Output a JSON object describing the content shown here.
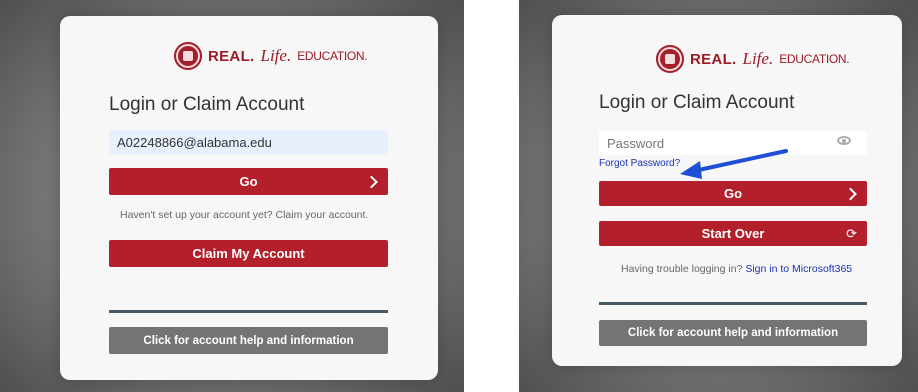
{
  "left": {
    "logo": {
      "seal": "university-seal-icon",
      "real": "REAL.",
      "life": "Life.",
      "edu": "EDUCATION."
    },
    "title": "Login or Claim Account",
    "email_value": "A02248866@alabama.edu",
    "go_label": "Go",
    "claim_note": "Haven't set up your account yet? Claim your account.",
    "claim_button": "Claim My Account",
    "help_button": "Click for account help and information"
  },
  "right": {
    "logo": {
      "seal": "university-seal-icon",
      "real": "REAL.",
      "life": "Life.",
      "edu": "EDUCATION."
    },
    "title": "Login or Claim Account",
    "password_placeholder": "Password",
    "forgot_link": "Forgot Password?",
    "go_label": "Go",
    "start_over_label": "Start Over",
    "trouble_text": "Having trouble logging in?",
    "trouble_link": "Sign in to Microsoft365",
    "help_button": "Click for account help and information"
  },
  "colors": {
    "brand_red": "#b3202b",
    "help_gray": "#747474",
    "link_blue": "#1a33b8",
    "annotation_arrow": "#1f4fd6"
  }
}
